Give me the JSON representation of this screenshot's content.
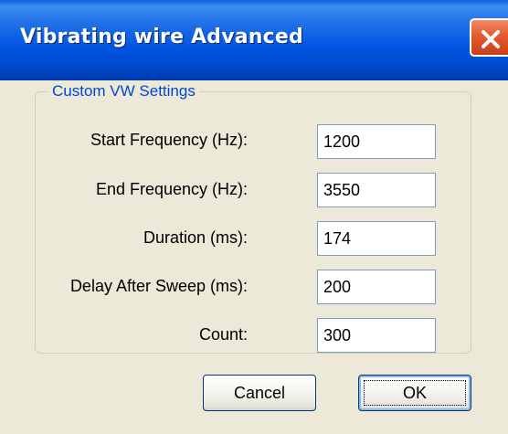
{
  "window": {
    "title": "Vibrating wire Advanced",
    "close_icon": "close-icon",
    "accent_color": "#0054e3",
    "close_color": "#e35a30"
  },
  "group": {
    "legend": "Custom VW Settings",
    "legend_color": "#0046d5"
  },
  "fields": [
    {
      "label": "Start Frequency (Hz):",
      "value": "1200"
    },
    {
      "label": "End Frequency (Hz):",
      "value": "3550"
    },
    {
      "label": "Duration (ms):",
      "value": "174"
    },
    {
      "label": "Delay After Sweep (ms):",
      "value": "200"
    },
    {
      "label": "Count:",
      "value": "300"
    }
  ],
  "buttons": {
    "cancel": "Cancel",
    "ok": "OK"
  }
}
